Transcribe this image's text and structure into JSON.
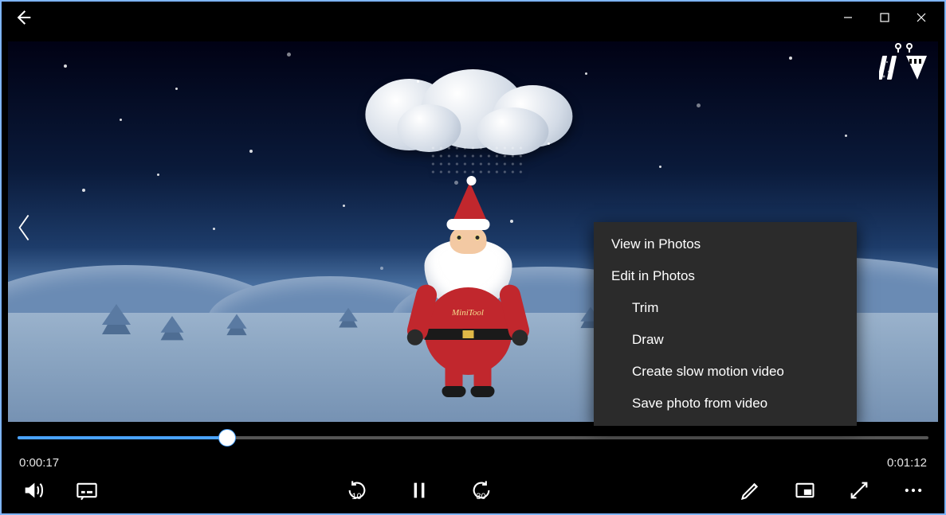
{
  "titlebar": {
    "back_button": "Back"
  },
  "player": {
    "current_time": "0:00:17",
    "total_time": "0:01:12",
    "progress_percent": 23,
    "skip_back_seconds": "10",
    "skip_forward_seconds": "30"
  },
  "scene": {
    "watermark_text": "MiniTool"
  },
  "context_menu": {
    "items": [
      {
        "label": "View in Photos",
        "sub": false
      },
      {
        "label": "Edit in Photos",
        "sub": false
      },
      {
        "label": "Trim",
        "sub": true
      },
      {
        "label": "Draw",
        "sub": true
      },
      {
        "label": "Create slow motion video",
        "sub": true
      },
      {
        "label": "Save photo from video",
        "sub": true
      }
    ]
  },
  "controls": {
    "volume": "Volume",
    "subtitles": "Subtitles and captions",
    "skip_back": "Skip back",
    "play_pause": "Pause",
    "skip_forward": "Skip forward",
    "edit": "Edit",
    "mini_view": "Play in mini view",
    "fullscreen": "Full screen",
    "more": "More options"
  }
}
